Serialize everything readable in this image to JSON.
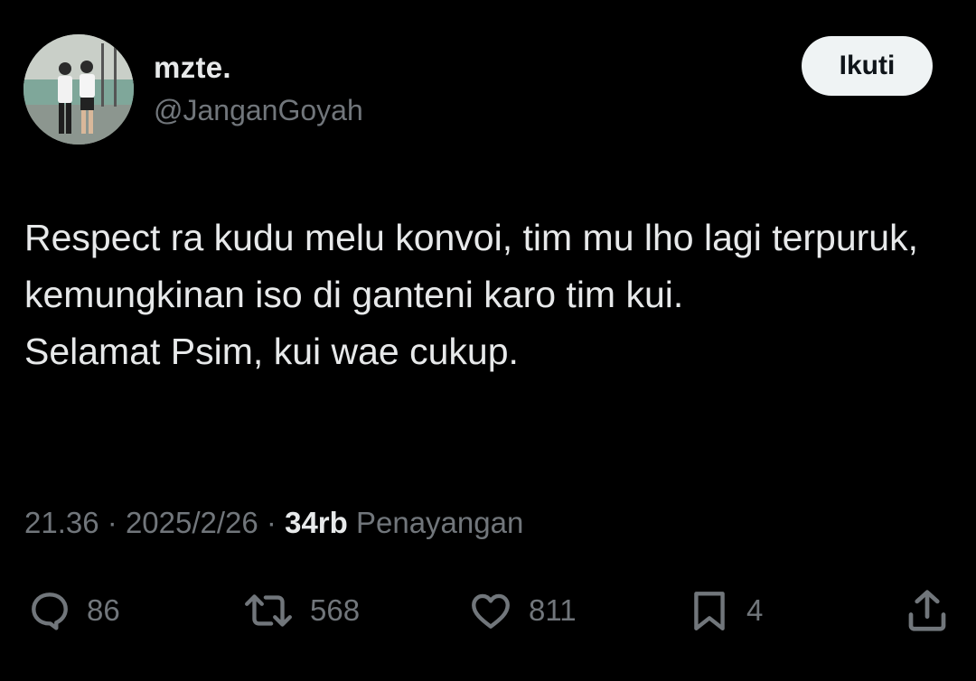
{
  "author": {
    "display_name": "mzte.",
    "handle": "@JanganGoyah"
  },
  "follow_label": "Ikuti",
  "tweet_lines": [
    "Respect ra kudu melu konvoi, tim mu lho lagi terpuruk, kemungkinan iso di ganteni karo tim kui.",
    "Selamat Psim, kui wae cukup."
  ],
  "meta": {
    "time": "21.36",
    "separator": "·",
    "date": "2025/2/26",
    "views_count": "34rb",
    "views_label": "Penayangan"
  },
  "stats": {
    "replies": "86",
    "reposts": "568",
    "likes": "811",
    "bookmarks": "4"
  },
  "colors": {
    "background": "#000000",
    "text_primary": "#e7e9ea",
    "text_secondary": "#71767b",
    "button_bg": "#eff3f4"
  }
}
